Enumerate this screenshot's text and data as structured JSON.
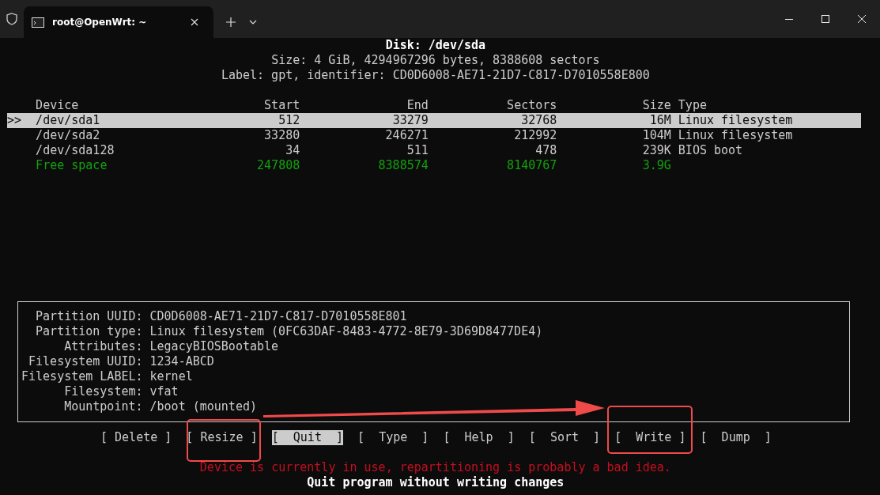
{
  "window": {
    "tab_title": "root@OpenWrt: ~"
  },
  "disk": {
    "title": "Disk: /dev/sda",
    "lines": [
      "Size: 4 GiB, 4294967296 bytes, 8388608 sectors",
      "Label: gpt, identifier: CD0D6008-AE71-21D7-C817-D7010558E800"
    ]
  },
  "table": {
    "columns": [
      "Device",
      "Start",
      "End",
      "Sectors",
      "Size",
      "Type"
    ],
    "rows": [
      {
        "kind": "partition",
        "selected": true,
        "cursor": ">>",
        "cells": [
          "/dev/sda1",
          "512",
          "33279",
          "32768",
          "16M",
          "Linux filesystem"
        ]
      },
      {
        "kind": "partition",
        "selected": false,
        "cells": [
          "/dev/sda2",
          "33280",
          "246271",
          "212992",
          "104M",
          "Linux filesystem"
        ]
      },
      {
        "kind": "partition",
        "selected": false,
        "cells": [
          "/dev/sda128",
          "34",
          "511",
          "478",
          "239K",
          "BIOS boot"
        ]
      },
      {
        "kind": "free",
        "selected": false,
        "cells": [
          "Free space",
          "247808",
          "8388574",
          "8140767",
          "3.9G",
          ""
        ]
      }
    ]
  },
  "details": [
    {
      "label": "Partition UUID:",
      "value": "CD0D6008-AE71-21D7-C817-D7010558E801"
    },
    {
      "label": "Partition type:",
      "value": "Linux filesystem (0FC63DAF-8483-4772-8E79-3D69D8477DE4)"
    },
    {
      "label": "Attributes:",
      "value": "LegacyBIOSBootable"
    },
    {
      "label": "Filesystem UUID:",
      "value": "1234-ABCD"
    },
    {
      "label": "Filesystem LABEL:",
      "value": "kernel"
    },
    {
      "label": "Filesystem:",
      "value": "vfat"
    },
    {
      "label": "Mountpoint:",
      "value": "/boot (mounted)"
    }
  ],
  "menu": [
    {
      "label": "[ Delete ]",
      "selected": false
    },
    {
      "label": "[ Resize ]",
      "selected": false
    },
    {
      "label": "[  Quit  ]",
      "selected": true
    },
    {
      "label": "[  Type  ]",
      "selected": false
    },
    {
      "label": "[  Help  ]",
      "selected": false
    },
    {
      "label": "[  Sort  ]",
      "selected": false
    },
    {
      "label": "[  Write ]",
      "selected": false
    },
    {
      "label": "[  Dump  ]",
      "selected": false
    }
  ],
  "warning": "Device is currently in use, repartitioning is probably a bad idea.",
  "status": "Quit program without writing changes"
}
